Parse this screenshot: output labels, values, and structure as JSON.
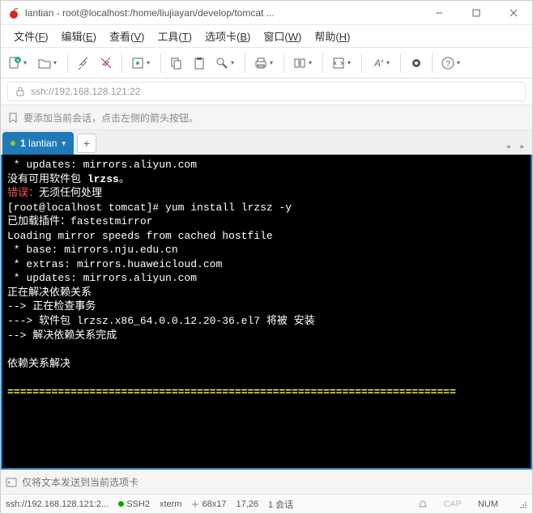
{
  "titlebar": {
    "title": "lantian - root@localhost:/home/liujiayan/develop/tomcat ..."
  },
  "menubar": {
    "file": "文件(F)",
    "edit": "编辑(E)",
    "view": "查看(V)",
    "tools": "工具(T)",
    "option": "选项卡(B)",
    "window": "窗口(W)",
    "help": "帮助(H)"
  },
  "addressbar": {
    "text": "ssh://192.168.128.121:22"
  },
  "hintbar": {
    "text": "要添加当前会话，点击左侧的箭头按钮。"
  },
  "tabbar": {
    "tab1_num": "1",
    "tab1_label": "lantian",
    "add": "+"
  },
  "terminal": {
    "l1": " * updates: mirrors.aliyun.com",
    "l2a": "没有可用软件包 ",
    "l2b": "lrzss",
    "l2c": "。",
    "l3a": "错误：",
    "l3b": "无须任何处理",
    "l4a": "[root@localhost tomcat]# ",
    "l4b": "yum install lrzsz -y",
    "l5": "已加载插件：fastestmirror",
    "l6": "Loading mirror speeds from cached hostfile",
    "l7": " * base: mirrors.nju.edu.cn",
    "l8": " * extras: mirrors.huaweicloud.com",
    "l9": " * updates: mirrors.aliyun.com",
    "l10": "正在解决依赖关系",
    "l11": "--> 正在检查事务",
    "l12": "---> 软件包 lrzsz.x86_64.0.0.12.20-36.el7 将被 安装",
    "l13": "--> 解决依赖关系完成",
    "l14": "",
    "l15": "依赖关系解决",
    "l16": "",
    "l17": "======================================================================="
  },
  "inputbar": {
    "placeholder": "仅将文本发送到当前选项卡"
  },
  "statusbar": {
    "host": "ssh://192.168.128.121:2...",
    "ssh": "SSH2",
    "term": "xterm",
    "size": "68x17",
    "pos": "17,26",
    "session": "1 会话",
    "cap": "CAP",
    "num": "NUM"
  }
}
